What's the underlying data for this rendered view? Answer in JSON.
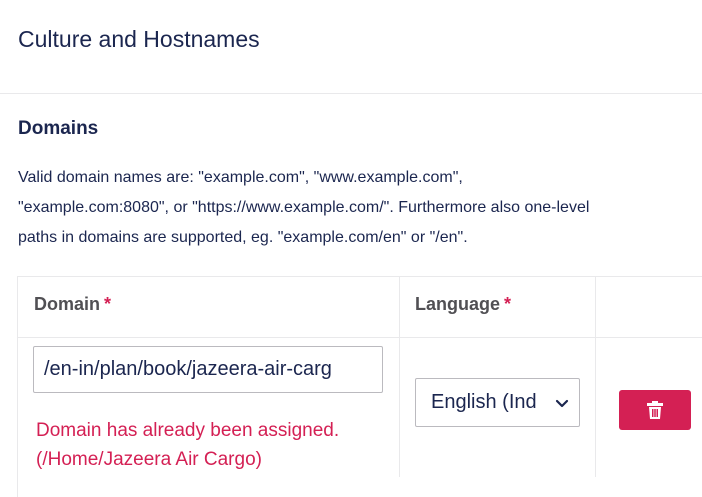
{
  "header": {
    "title": "Culture and Hostnames"
  },
  "domains": {
    "title": "Domains",
    "help_line1": "Valid domain names are: \"example.com\", \"www.example.com\",",
    "help_line2": "\"example.com:8080\", or \"https://www.example.com/\". Furthermore also one-level",
    "help_line3": "paths in domains are supported, eg. \"example.com/en\" or \"/en\".",
    "table": {
      "columns": {
        "domain": "Domain",
        "language": "Language",
        "required_marker": "*"
      },
      "rows": [
        {
          "domain_value": "/en-in/plan/book/jazeera-air-carg",
          "error_line1": "Domain has already been assigned.",
          "error_line2": "(/Home/Jazeera Air Cargo)",
          "language": "English (Ind"
        }
      ]
    }
  },
  "icons": {
    "delete": "trash-icon",
    "dropdown": "chevron-down-icon"
  },
  "colors": {
    "danger": "#d42054",
    "text": "#1b264f",
    "border": "#e9e9eb"
  }
}
